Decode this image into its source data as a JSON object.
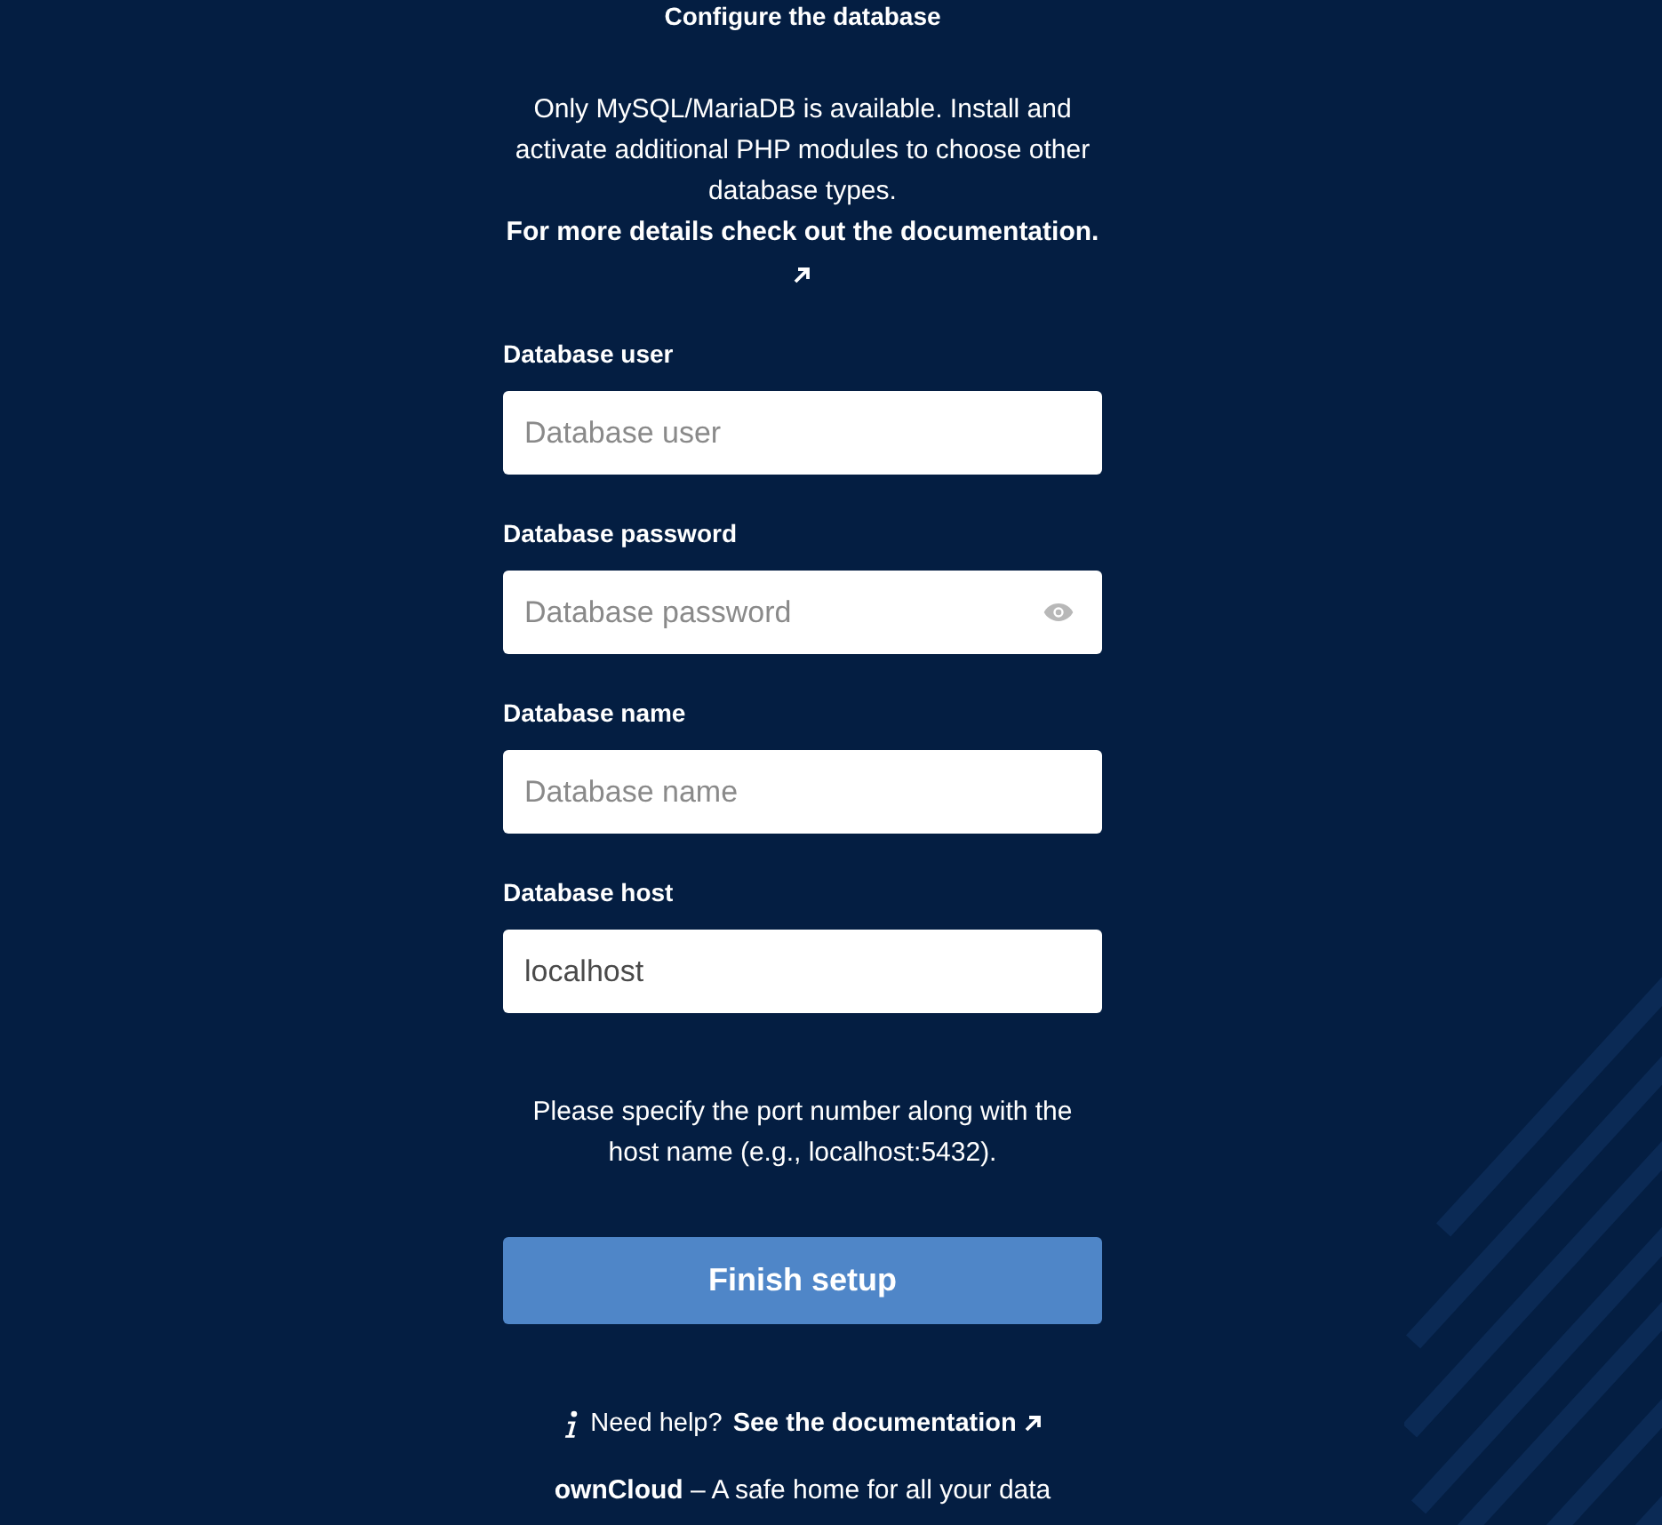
{
  "heading": "Configure the database",
  "notice": {
    "text": "Only MySQL/MariaDB is available. Install and activate additional PHP modules to choose other database types.",
    "link": "For more details check out the documentation."
  },
  "fields": [
    {
      "kind": "text",
      "label": "Database user",
      "placeholder": "Database user"
    },
    {
      "kind": "password",
      "label": "Database password",
      "placeholder": "Database password"
    },
    {
      "kind": "text",
      "label": "Database name",
      "placeholder": "Database name"
    },
    {
      "kind": "text",
      "label": "Database host",
      "value": "localhost"
    }
  ],
  "hint": "Please specify the port number along with the host name (e.g., localhost:5432).",
  "submit": "Finish setup",
  "help": {
    "text": "Need help?",
    "link": "See the documentation"
  },
  "footer": "**ownCloud** – A safe home for all your data"
}
